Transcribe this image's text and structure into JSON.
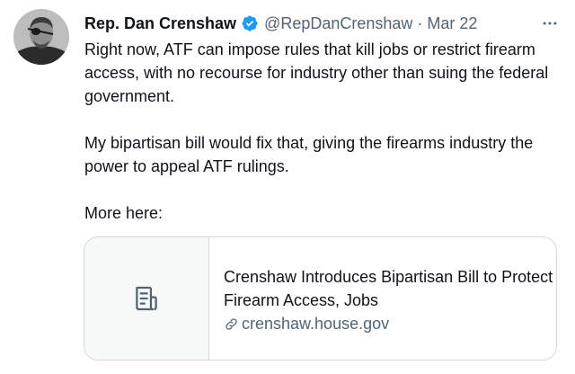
{
  "tweet": {
    "author": {
      "display_name": "Rep. Dan Crenshaw",
      "handle": "@RepDanCrenshaw",
      "separator": "·",
      "date": "Mar 22",
      "verified": true,
      "avatar_icon": "profile-photo"
    },
    "more_icon": "more-horizontal-icon",
    "text": {
      "paragraph_1": "Right now, ATF can impose rules that kill jobs or restrict firearm access, with no recourse for industry other than suing the federal government.",
      "paragraph_2": "My bipartisan bill would fix that, giving the firearms industry the power to appeal ATF rulings.",
      "paragraph_3": "More here:"
    },
    "card": {
      "thumbnail_icon": "document-icon",
      "title": "Crenshaw Introduces Bipartisan Bill to Protect Firearm Access, Jobs",
      "link_icon": "link-icon",
      "domain": "crenshaw.house.gov"
    },
    "colors": {
      "primary_text": "#0f1419",
      "secondary_text": "#536471",
      "verified_badge": "#1d9bf0",
      "card_border": "#cfd9de",
      "card_thumb_bg": "#f7f9f9"
    }
  }
}
